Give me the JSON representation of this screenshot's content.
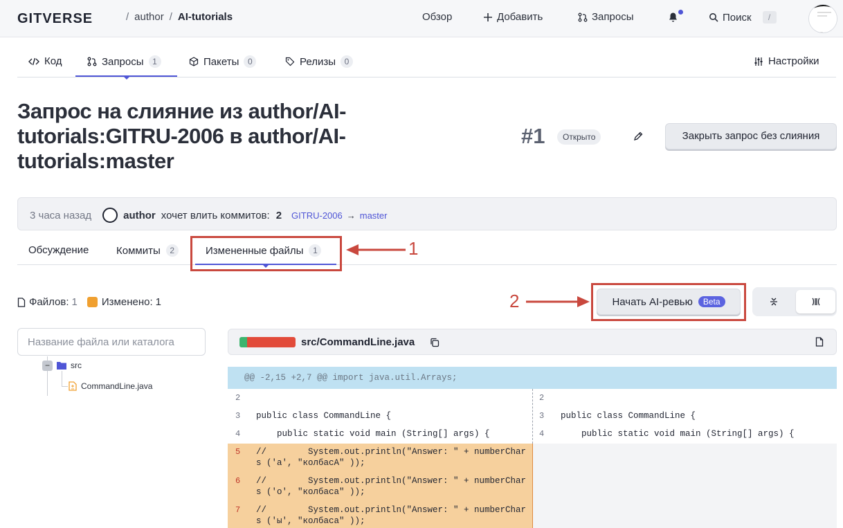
{
  "header": {
    "logo": "GITVERSE",
    "breadcrumb": {
      "owner": "author",
      "separator": "/",
      "repo": "AI-tutorials"
    },
    "nav": {
      "overview": "Обзор",
      "add": "Добавить",
      "requests": "Запросы",
      "search": "Поиск",
      "search_shortcut": "/"
    },
    "icons": [
      "plus-icon",
      "pull-request-icon",
      "bell-icon",
      "search-icon"
    ]
  },
  "repo_tabs": [
    {
      "label": "Код",
      "icon": "code-icon"
    },
    {
      "label": "Запросы",
      "count": "1",
      "icon": "pull-request-icon",
      "active": true
    },
    {
      "label": "Пакеты",
      "count": "0",
      "icon": "package-icon"
    },
    {
      "label": "Релизы",
      "count": "0",
      "icon": "tag-icon"
    }
  ],
  "settings_label": "Настройки",
  "pr": {
    "title": "Запрос на слияние из author/AI-tutorials:GITRU-2006 в author/AI-tutorials:master",
    "number": "#1",
    "state": "Открыто",
    "close_button": "Закрыть запрос без слияния"
  },
  "info": {
    "time": "3 часа назад",
    "author": "author",
    "action": "хочет влить коммитов:",
    "commits": "2",
    "source_branch": "GITRU-2006",
    "arrow": "→",
    "target_branch": "master"
  },
  "sub_tabs": [
    {
      "label": "Обсуждение"
    },
    {
      "label": "Коммиты",
      "count": "2"
    },
    {
      "label": "Измененные файлы",
      "count": "1",
      "active": true
    }
  ],
  "annotations": {
    "one": "1",
    "two": "2",
    "color": "#c9483e"
  },
  "files": {
    "files_label": "Файлов:",
    "files_count": "1",
    "changed_label": "Изменено:",
    "changed_count": "1",
    "ai_review_button": "Начать AI-ревью",
    "beta_badge": "Beta",
    "search_placeholder": "Название файла или каталога"
  },
  "tree": [
    {
      "name": "src",
      "type": "folder"
    },
    {
      "name": "CommandLine.java",
      "type": "file"
    }
  ],
  "diff": {
    "file_path": "src/CommandLine.java",
    "hunk": "@@ -2,15 +2,7 @@ import java.util.Arrays;",
    "left": [
      {
        "num": "2",
        "text": ""
      },
      {
        "num": "3",
        "text": "public class CommandLine {"
      },
      {
        "num": "4",
        "text": "    public static void main (String[] args) {"
      },
      {
        "num": "5",
        "text": "//        System.out.println(\"Answer: \" + numberChar",
        "cont": "s ('а', \"колбасА\" ));"
      },
      {
        "num": "6",
        "text": "//        System.out.println(\"Answer: \" + numberChar",
        "cont": "s ('о', \"колбаса\" ));"
      },
      {
        "num": "7",
        "text": "//        System.out.println(\"Answer: \" + numberChar",
        "cont": "s ('ы', \"колбаса\" ));"
      }
    ],
    "right": [
      {
        "num": "2",
        "text": ""
      },
      {
        "num": "3",
        "text": "public class CommandLine {"
      },
      {
        "num": "4",
        "text": "    public static void main (String[] args) {"
      }
    ]
  },
  "colors": {
    "accent": "#4f55d6",
    "deleted_bg": "#f6d09d",
    "hunk_bg": "#bfe1f2",
    "changed": "#f0a030"
  }
}
